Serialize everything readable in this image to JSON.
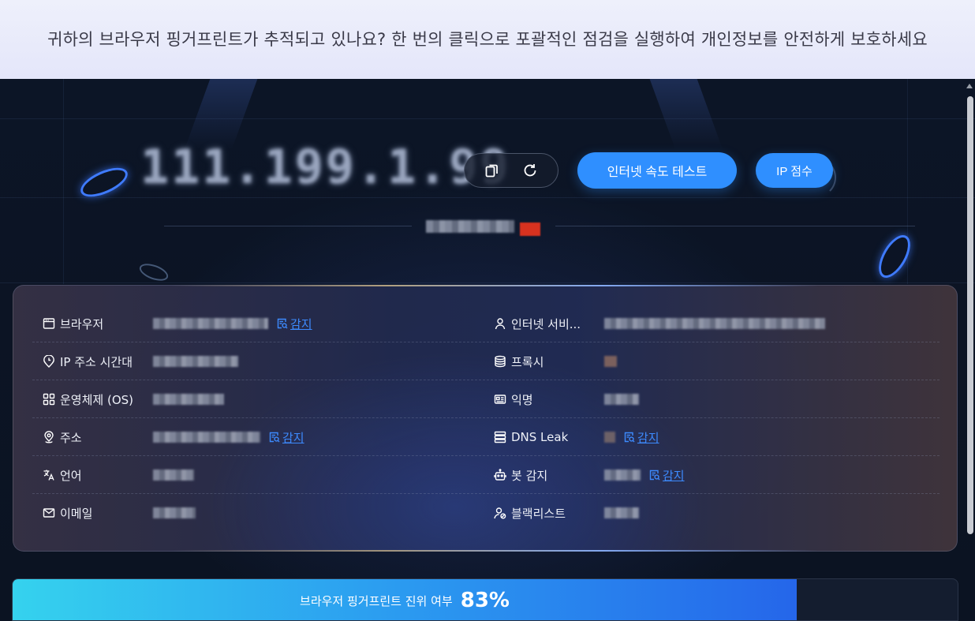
{
  "banner": {
    "text": "귀하의 브라우저 핑거프린트가 추적되고 있나요? 한 번의 클릭으로 포괄적인 점검을 실행하여 개인정보를 안전하게 보호하세요"
  },
  "header": {
    "ip_address": "111.199.1.99",
    "copy_icon": "copy-icon",
    "refresh_icon": "refresh-icon",
    "speed_test_label": "인터넷 속도 테스트",
    "ip_score_label": "IP 점수"
  },
  "info": {
    "detect_label": "감지",
    "rows": [
      {
        "left": {
          "icon": "browser-window-icon",
          "label": "브라우저",
          "has_detect": true
        },
        "right": {
          "icon": "user-icon",
          "label": "인터넷 서비...",
          "has_detect": false
        }
      },
      {
        "left": {
          "icon": "clock-pin-icon",
          "label": "IP 주소 시간대",
          "has_detect": false
        },
        "right": {
          "icon": "database-icon",
          "label": "프록시",
          "has_detect": false
        }
      },
      {
        "left": {
          "icon": "grid-icon",
          "label": "운영체제 (OS)",
          "has_detect": false
        },
        "right": {
          "icon": "id-card-icon",
          "label": "익명",
          "has_detect": false
        }
      },
      {
        "left": {
          "icon": "location-pin-icon",
          "label": "주소",
          "has_detect": true
        },
        "right": {
          "icon": "server-icon",
          "label": "DNS Leak",
          "has_detect": true
        }
      },
      {
        "left": {
          "icon": "translate-icon",
          "label": "언어",
          "has_detect": false
        },
        "right": {
          "icon": "robot-icon",
          "label": "봇 감지",
          "has_detect": true
        }
      },
      {
        "left": {
          "icon": "mail-icon",
          "label": "이메일",
          "has_detect": false
        },
        "right": {
          "icon": "user-blocked-icon",
          "label": "블랙리스트",
          "has_detect": false
        }
      }
    ]
  },
  "progress": {
    "label": "브라우저 핑거프린트 진위 여부",
    "value_text": "83%",
    "fraction": 0.83
  },
  "colors": {
    "accent": "#2f8fff",
    "link": "#3d8bff",
    "progress_start": "#35d2ee",
    "progress_end": "#2566ea"
  }
}
